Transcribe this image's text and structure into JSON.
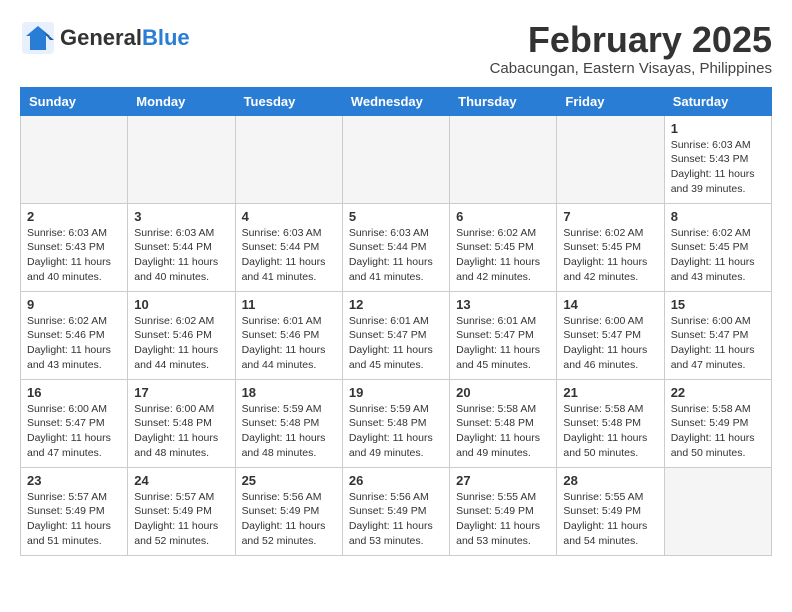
{
  "header": {
    "logo_general": "General",
    "logo_blue": "Blue",
    "month_title": "February 2025",
    "location": "Cabacungan, Eastern Visayas, Philippines"
  },
  "calendar": {
    "days_of_week": [
      "Sunday",
      "Monday",
      "Tuesday",
      "Wednesday",
      "Thursday",
      "Friday",
      "Saturday"
    ],
    "weeks": [
      [
        {
          "day": "",
          "empty": true
        },
        {
          "day": "",
          "empty": true
        },
        {
          "day": "",
          "empty": true
        },
        {
          "day": "",
          "empty": true
        },
        {
          "day": "",
          "empty": true
        },
        {
          "day": "",
          "empty": true
        },
        {
          "day": "1",
          "sunrise": "6:03 AM",
          "sunset": "5:43 PM",
          "daylight": "11 hours and 39 minutes."
        }
      ],
      [
        {
          "day": "2",
          "sunrise": "6:03 AM",
          "sunset": "5:43 PM",
          "daylight": "11 hours and 40 minutes."
        },
        {
          "day": "3",
          "sunrise": "6:03 AM",
          "sunset": "5:44 PM",
          "daylight": "11 hours and 40 minutes."
        },
        {
          "day": "4",
          "sunrise": "6:03 AM",
          "sunset": "5:44 PM",
          "daylight": "11 hours and 41 minutes."
        },
        {
          "day": "5",
          "sunrise": "6:03 AM",
          "sunset": "5:44 PM",
          "daylight": "11 hours and 41 minutes."
        },
        {
          "day": "6",
          "sunrise": "6:02 AM",
          "sunset": "5:45 PM",
          "daylight": "11 hours and 42 minutes."
        },
        {
          "day": "7",
          "sunrise": "6:02 AM",
          "sunset": "5:45 PM",
          "daylight": "11 hours and 42 minutes."
        },
        {
          "day": "8",
          "sunrise": "6:02 AM",
          "sunset": "5:45 PM",
          "daylight": "11 hours and 43 minutes."
        }
      ],
      [
        {
          "day": "9",
          "sunrise": "6:02 AM",
          "sunset": "5:46 PM",
          "daylight": "11 hours and 43 minutes."
        },
        {
          "day": "10",
          "sunrise": "6:02 AM",
          "sunset": "5:46 PM",
          "daylight": "11 hours and 44 minutes."
        },
        {
          "day": "11",
          "sunrise": "6:01 AM",
          "sunset": "5:46 PM",
          "daylight": "11 hours and 44 minutes."
        },
        {
          "day": "12",
          "sunrise": "6:01 AM",
          "sunset": "5:47 PM",
          "daylight": "11 hours and 45 minutes."
        },
        {
          "day": "13",
          "sunrise": "6:01 AM",
          "sunset": "5:47 PM",
          "daylight": "11 hours and 45 minutes."
        },
        {
          "day": "14",
          "sunrise": "6:00 AM",
          "sunset": "5:47 PM",
          "daylight": "11 hours and 46 minutes."
        },
        {
          "day": "15",
          "sunrise": "6:00 AM",
          "sunset": "5:47 PM",
          "daylight": "11 hours and 47 minutes."
        }
      ],
      [
        {
          "day": "16",
          "sunrise": "6:00 AM",
          "sunset": "5:47 PM",
          "daylight": "11 hours and 47 minutes."
        },
        {
          "day": "17",
          "sunrise": "6:00 AM",
          "sunset": "5:48 PM",
          "daylight": "11 hours and 48 minutes."
        },
        {
          "day": "18",
          "sunrise": "5:59 AM",
          "sunset": "5:48 PM",
          "daylight": "11 hours and 48 minutes."
        },
        {
          "day": "19",
          "sunrise": "5:59 AM",
          "sunset": "5:48 PM",
          "daylight": "11 hours and 49 minutes."
        },
        {
          "day": "20",
          "sunrise": "5:58 AM",
          "sunset": "5:48 PM",
          "daylight": "11 hours and 49 minutes."
        },
        {
          "day": "21",
          "sunrise": "5:58 AM",
          "sunset": "5:48 PM",
          "daylight": "11 hours and 50 minutes."
        },
        {
          "day": "22",
          "sunrise": "5:58 AM",
          "sunset": "5:49 PM",
          "daylight": "11 hours and 50 minutes."
        }
      ],
      [
        {
          "day": "23",
          "sunrise": "5:57 AM",
          "sunset": "5:49 PM",
          "daylight": "11 hours and 51 minutes."
        },
        {
          "day": "24",
          "sunrise": "5:57 AM",
          "sunset": "5:49 PM",
          "daylight": "11 hours and 52 minutes."
        },
        {
          "day": "25",
          "sunrise": "5:56 AM",
          "sunset": "5:49 PM",
          "daylight": "11 hours and 52 minutes."
        },
        {
          "day": "26",
          "sunrise": "5:56 AM",
          "sunset": "5:49 PM",
          "daylight": "11 hours and 53 minutes."
        },
        {
          "day": "27",
          "sunrise": "5:55 AM",
          "sunset": "5:49 PM",
          "daylight": "11 hours and 53 minutes."
        },
        {
          "day": "28",
          "sunrise": "5:55 AM",
          "sunset": "5:49 PM",
          "daylight": "11 hours and 54 minutes."
        },
        {
          "day": "",
          "empty": true
        }
      ]
    ]
  }
}
